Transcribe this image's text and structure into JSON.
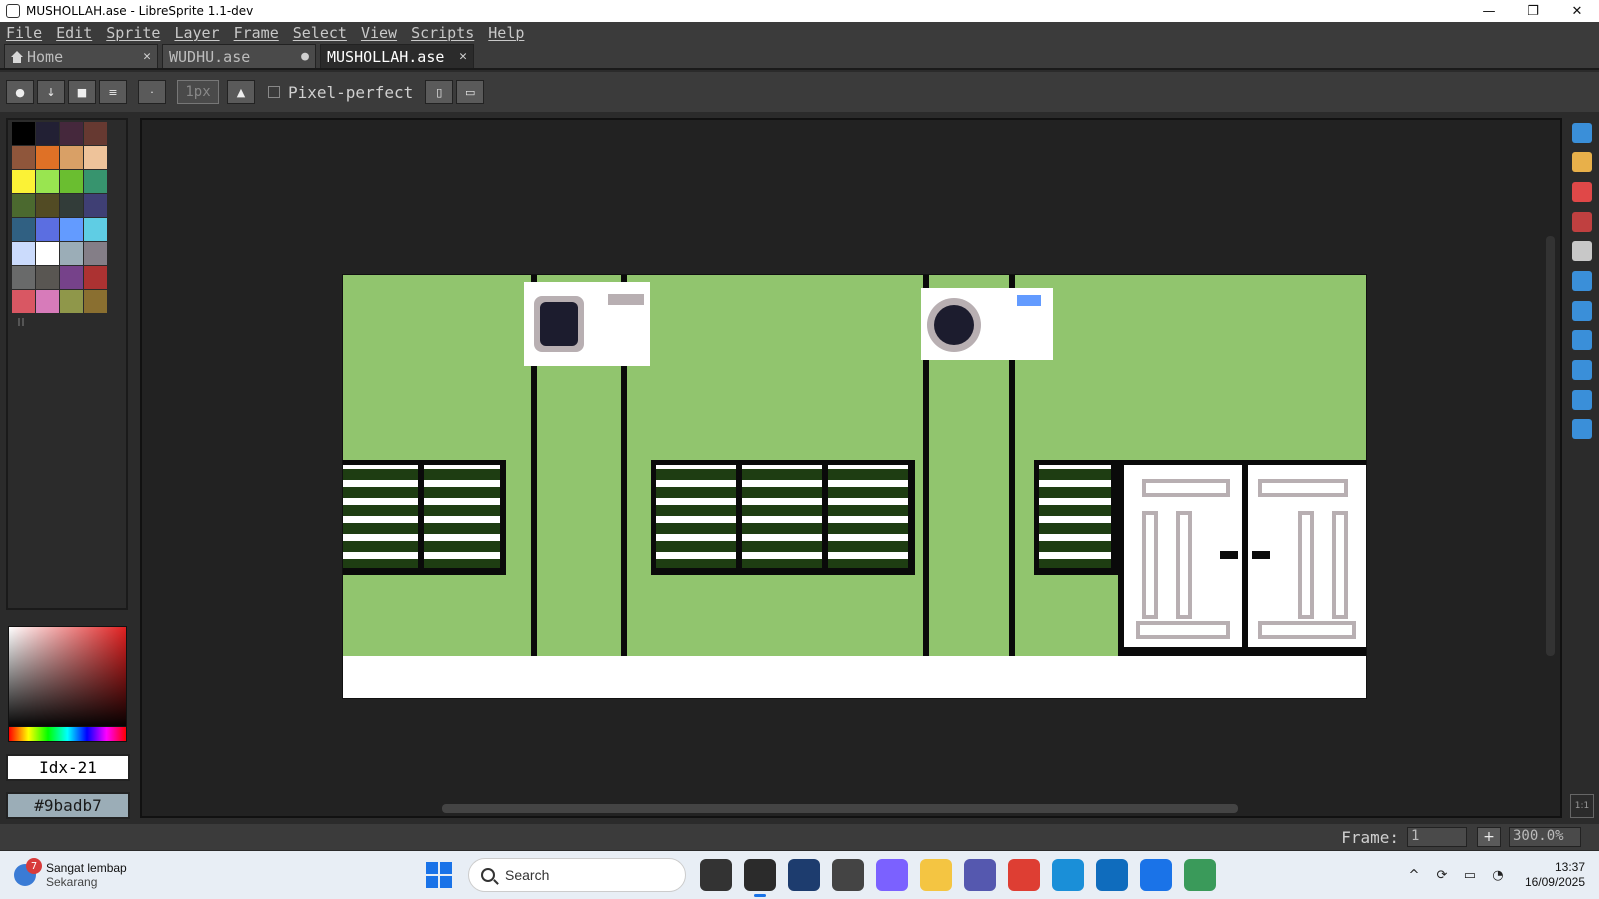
{
  "window": {
    "title": "MUSHOLLAH.ase - LibreSprite 1.1-dev",
    "minimize_glyph": "—",
    "maximize_glyph": "❐",
    "close_glyph": "✕"
  },
  "menu": [
    "File",
    "Edit",
    "Sprite",
    "Layer",
    "Frame",
    "Select",
    "View",
    "Scripts",
    "Help"
  ],
  "tabs": [
    {
      "label": "Home",
      "close": "✕"
    },
    {
      "label": "WUDHU.ase",
      "close": "●"
    },
    {
      "label": "MUSHOLLAH.ase",
      "close": "✕"
    }
  ],
  "context_bar": {
    "brush_size": "1px",
    "pixel_perfect_label": "Pixel-perfect",
    "pixel_perfect_checked": false
  },
  "palette": {
    "colors": [
      "#000000",
      "#222034",
      "#45283c",
      "#663931",
      "#8f563b",
      "#df7126",
      "#d9a066",
      "#eec39a",
      "#fbf236",
      "#99e550",
      "#6abe30",
      "#37946e",
      "#4b692f",
      "#524b24",
      "#323c39",
      "#3f3f74",
      "#306082",
      "#5b6ee1",
      "#639bff",
      "#5fcde4",
      "#cbdbfc",
      "#ffffff",
      "#9badb7",
      "#847e87",
      "#696a6a",
      "#595652",
      "#76428a",
      "#ac3232",
      "#d95763",
      "#d77bba",
      "#8f974a",
      "#8a6f30"
    ],
    "selected_index": 21
  },
  "color_bar": {
    "index_label": "Idx-21",
    "hex_label": "#9badb7",
    "fg_color": "#9badb7"
  },
  "tools": [
    {
      "icon": "marquee-icon",
      "color": "#3a8fd9"
    },
    {
      "icon": "pencil-icon",
      "color": "#e8b04a"
    },
    {
      "icon": "eraser-icon",
      "color": "#e04848"
    },
    {
      "icon": "eyedropper-icon",
      "color": "#c04040"
    },
    {
      "icon": "zoom-icon",
      "color": "#c8c8c8"
    },
    {
      "icon": "move-icon",
      "color": "#3a8fd9"
    },
    {
      "icon": "fill-icon",
      "color": "#3a8fd9"
    },
    {
      "icon": "line-icon",
      "color": "#3a8fd9"
    },
    {
      "icon": "rectangle-icon",
      "color": "#3a8fd9"
    },
    {
      "icon": "lasso-icon",
      "color": "#3a8fd9"
    },
    {
      "icon": "blur-icon",
      "color": "#3a8fd9"
    }
  ],
  "one_to_one": "1:1",
  "status": {
    "frame_label": "Frame:",
    "frame_value": "1",
    "plus": "+",
    "zoom": "300.0%"
  },
  "taskbar": {
    "weather_badge": "7",
    "weather_title": "Sangat lembap",
    "weather_sub": "Sekarang",
    "search_placeholder": "Search",
    "apps": [
      {
        "icon": "task-view-icon",
        "color": "#333333"
      },
      {
        "icon": "libresprite-icon",
        "color": "#2b2b2b",
        "active": true
      },
      {
        "icon": "solitaire-icon",
        "color": "#1d3c6e"
      },
      {
        "icon": "cube-app-icon",
        "color": "#444444"
      },
      {
        "icon": "copilot-icon",
        "color": "#7b61ff"
      },
      {
        "icon": "file-explorer-icon",
        "color": "#f4c542"
      },
      {
        "icon": "teams-icon",
        "color": "#5558af"
      },
      {
        "icon": "chrome-icon",
        "color": "#de3e33"
      },
      {
        "icon": "edge-icon",
        "color": "#1a8fd8"
      },
      {
        "icon": "outlook-icon",
        "color": "#0f6cbd"
      },
      {
        "icon": "store-icon",
        "color": "#1a73e8"
      },
      {
        "icon": "cards-icon",
        "color": "#3a9a5a"
      }
    ],
    "time": "13:37",
    "date": "16/09/2025"
  }
}
